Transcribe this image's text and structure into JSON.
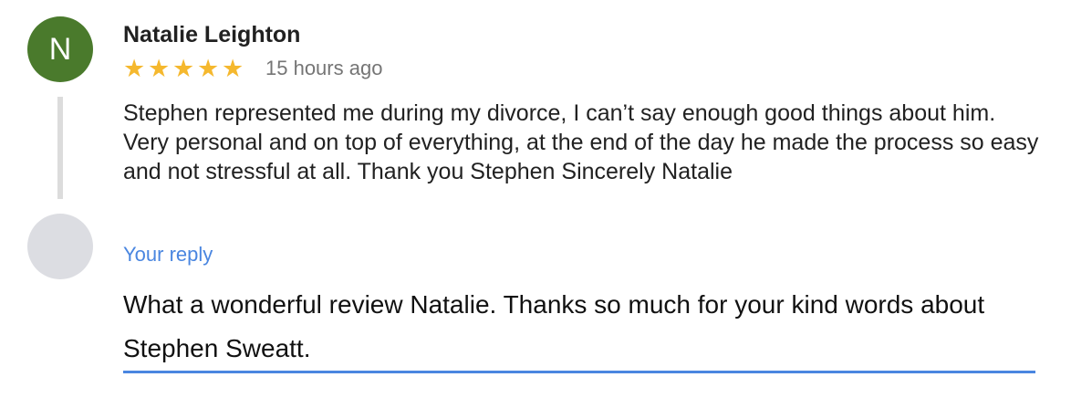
{
  "review": {
    "avatar_letter": "N",
    "reviewer_name": "Natalie Leighton",
    "rating": 5,
    "stars": [
      "★",
      "★",
      "★",
      "★",
      "★"
    ],
    "time": "15 hours ago",
    "text": "Stephen represented me during my divorce, I can’t say enough good things about him. Very personal and on top of everything, at the end of the day he made the process so easy and not stressful at all. Thank you Stephen Sincerely Natalie"
  },
  "reply": {
    "label": "Your reply",
    "value": "What a wonderful review Natalie.  Thanks so much for your kind words about Stephen Sweatt."
  },
  "colors": {
    "avatar": "#4a7a2c",
    "star": "#f5b82e",
    "accent": "#4a86e0",
    "thread_line": "#dcdcdc",
    "reply_avatar": "#dcdde2"
  }
}
